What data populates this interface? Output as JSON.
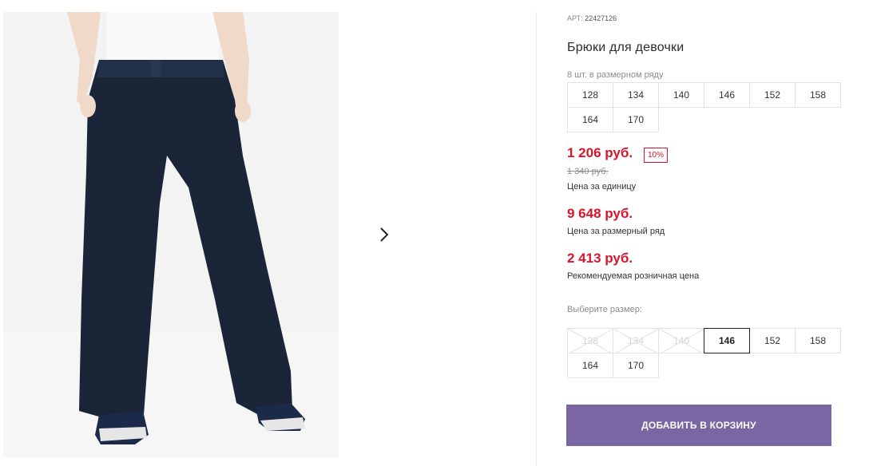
{
  "product": {
    "article_label": "АРТ:",
    "article_number": "22427126",
    "title": "Брюки для девочки",
    "size_count": "8 шт. в размерном ряду"
  },
  "size_range": [
    "128",
    "134",
    "140",
    "146",
    "152",
    "158",
    "164",
    "170"
  ],
  "prices": {
    "unit_price": "1 206 руб.",
    "discount": "10%",
    "old_price": "1 340 руб.",
    "unit_caption": "Цена за единицу",
    "range_price": "9 648 руб.",
    "range_caption": "Цена за размерный ряд",
    "retail_price": "2 413 руб.",
    "retail_caption": "Рекомендуемая розничная цена"
  },
  "size_select": {
    "label": "Выберите размер:",
    "options": [
      {
        "size": "128",
        "available": false
      },
      {
        "size": "134",
        "available": false
      },
      {
        "size": "140",
        "available": false
      },
      {
        "size": "146",
        "available": true,
        "selected": true
      },
      {
        "size": "152",
        "available": true
      },
      {
        "size": "158",
        "available": true
      },
      {
        "size": "164",
        "available": true
      },
      {
        "size": "170",
        "available": true
      }
    ]
  },
  "add_to_cart_label": "ДОБАВИТЬ В КОРЗИНУ",
  "icons": {
    "gallery_next": "chevron-right-icon"
  },
  "colors": {
    "accent": "#7a66a3",
    "price": "#d8152b",
    "pants": "#1b2538"
  }
}
